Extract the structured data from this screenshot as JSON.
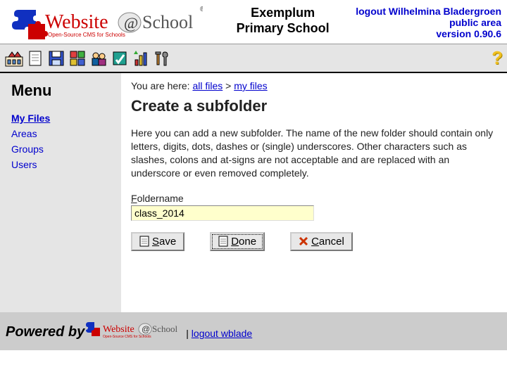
{
  "header": {
    "title_line1": "Exemplum",
    "title_line2": "Primary School",
    "logout_label": "logout Wilhelmina Bladergroen",
    "public_area_label": "public area",
    "version_label": "version 0.90.6"
  },
  "breadcrumb": {
    "prefix": "You are here: ",
    "all_files": "all files",
    "sep": " > ",
    "my_files": "my files"
  },
  "menu": {
    "heading": "Menu",
    "items": [
      {
        "label": "My Files",
        "active": true
      },
      {
        "label": "Areas"
      },
      {
        "label": "Groups"
      },
      {
        "label": "Users"
      }
    ]
  },
  "page": {
    "heading": "Create a subfolder",
    "description": "Here you can add a new subfolder. The name of the new folder should contain only letters, digits, dots, dashes or (single) underscores. Other characters such as slashes, colons and at-signs are not acceptable and are replaced with an underscore or even removed completely.",
    "field": {
      "hotkey": "F",
      "rest": "oldername",
      "value": "class_2014"
    },
    "buttons": {
      "save": {
        "hotkey": "S",
        "rest": "ave"
      },
      "done": {
        "hotkey": "D",
        "rest": "one"
      },
      "cancel": {
        "hotkey": "C",
        "rest": "ancel"
      }
    }
  },
  "footer": {
    "powered": "Powered by",
    "sep": " | ",
    "logout": "logout wblade"
  },
  "help_glyph": "?"
}
